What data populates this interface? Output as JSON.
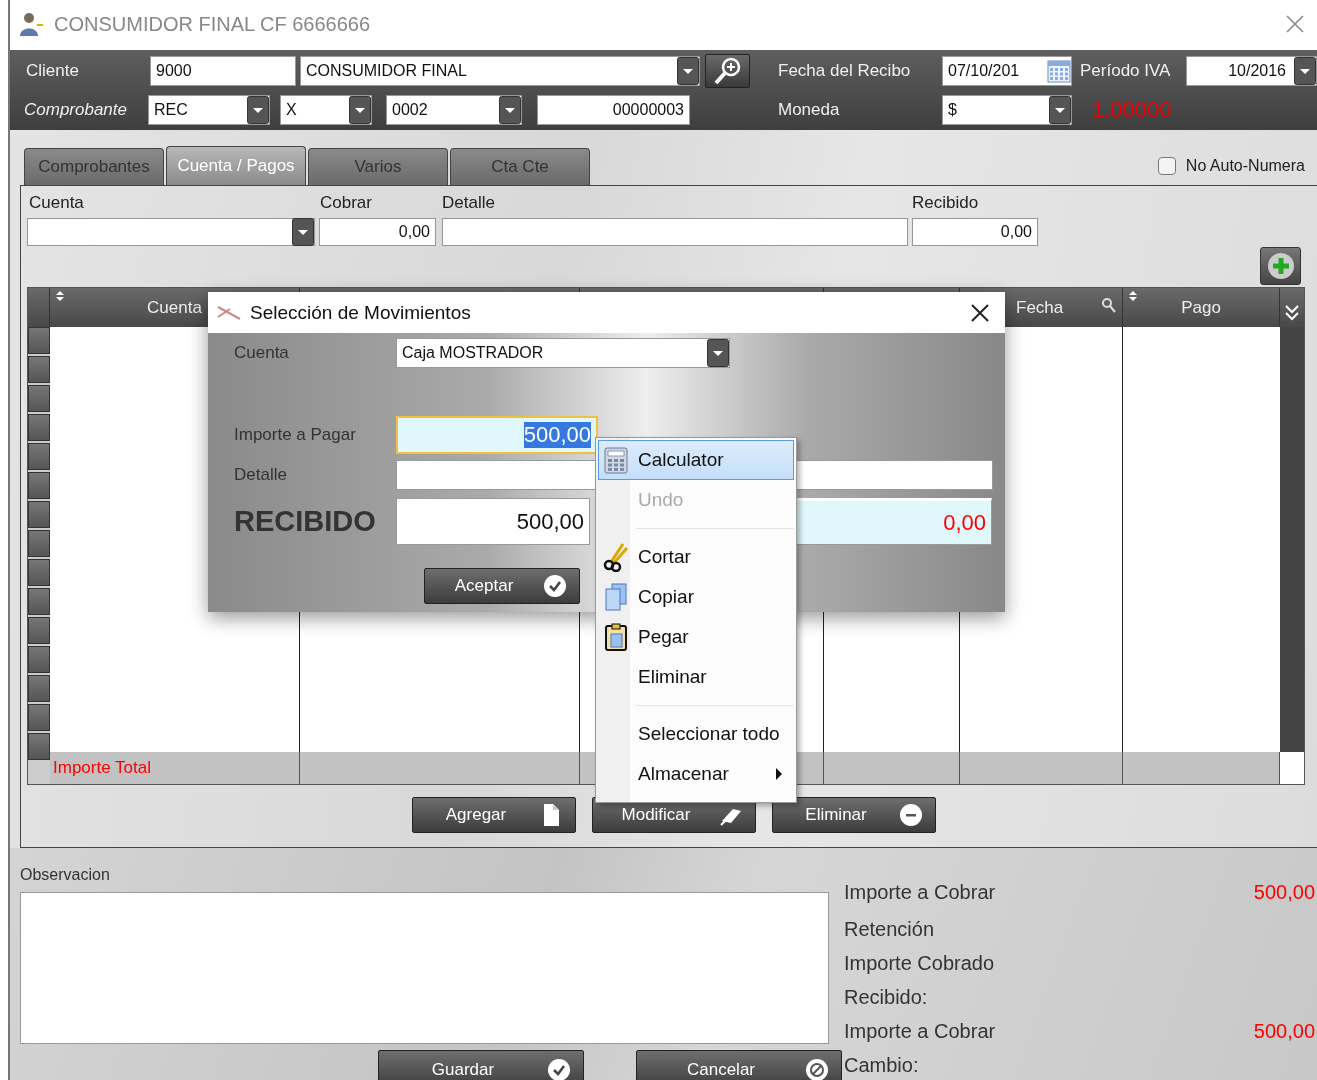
{
  "window": {
    "title": "CONSUMIDOR FINAL CF 6666666"
  },
  "header": {
    "cliente_label": "Cliente",
    "cliente_code": "9000",
    "cliente_name": "CONSUMIDOR FINAL",
    "fecha_label": "Fecha del Recibo",
    "fecha_value": "07/10/201",
    "periodo_label": "Período IVA",
    "periodo_value": "10/2016",
    "comprobante_label": "Comprobante",
    "comprobante_tipo": "REC",
    "comprobante_letra": "X",
    "comprobante_punto": "0002",
    "comprobante_numero": "00000003",
    "moneda_label": "Moneda",
    "moneda_value": "$",
    "cotizacion": "1,00000"
  },
  "tabs": [
    {
      "label": "Comprobantes",
      "selected": false
    },
    {
      "label": "Cuenta / Pagos",
      "selected": true
    },
    {
      "label": "Varios",
      "selected": false
    },
    {
      "label": "Cta Cte",
      "selected": false
    }
  ],
  "no_auto_numera": {
    "label": "No Auto-Numera",
    "checked": false
  },
  "entry": {
    "cuenta_label": "Cuenta",
    "cobrar_label": "Cobrar",
    "cobrar_value": "0,00",
    "detalle_label": "Detalle",
    "recibido_label": "Recibido",
    "recibido_value": "0,00"
  },
  "grid": {
    "columns": [
      {
        "label": "Cuenta"
      },
      {
        "label": "Fecha"
      },
      {
        "label": "Pago"
      }
    ],
    "total_label": "Importe Total"
  },
  "grid_buttons": [
    {
      "label": "Agregar",
      "kind": "add"
    },
    {
      "label": "Modificar",
      "kind": "edit"
    },
    {
      "label": "Eliminar",
      "kind": "delete"
    }
  ],
  "observacion_label": "Observacion",
  "summary": [
    {
      "label": "Importe a Cobrar",
      "value": "500,00"
    },
    {
      "label": "Retención"
    },
    {
      "label": "Importe Cobrado"
    },
    {
      "label": "Recibido:"
    },
    {
      "label": "Importe a Cobrar",
      "value": "500,00"
    },
    {
      "label": "Cambio:"
    }
  ],
  "footer_buttons": [
    {
      "label": "Guardar",
      "kind": "ok"
    },
    {
      "label": "Cancelar",
      "kind": "cancel"
    }
  ],
  "dialog": {
    "title": "Selección de Movimientos",
    "cuenta_label": "Cuenta",
    "cuenta_value": "Caja MOSTRADOR",
    "importe_label": "Importe a Pagar",
    "importe": {
      "value": "500,00",
      "focused": true
    },
    "detalle_label": "Detalle",
    "recibido_label": "RECIBIDO",
    "recibido_value": "500,00",
    "vuelto_value": "0,00",
    "accept": "Aceptar"
  },
  "context_menu": [
    {
      "label": "Calculator",
      "kind": "calculator",
      "selected": true,
      "disabled": false
    },
    {
      "label": "Undo",
      "kind": "plain",
      "selected": false,
      "disabled": true
    },
    {
      "kind": "separator"
    },
    {
      "label": "Cortar",
      "kind": "scissors",
      "selected": false,
      "disabled": false
    },
    {
      "label": "Copiar",
      "kind": "copy",
      "selected": false,
      "disabled": false
    },
    {
      "label": "Pegar",
      "kind": "paste",
      "selected": false,
      "disabled": false
    },
    {
      "label": "Eliminar",
      "kind": "plain",
      "selected": false,
      "disabled": false
    },
    {
      "kind": "separator"
    },
    {
      "label": "Seleccionar todo",
      "kind": "plain",
      "selected": false,
      "disabled": false
    },
    {
      "label": "Almacenar",
      "kind": "submenu",
      "selected": false,
      "disabled": false
    }
  ]
}
